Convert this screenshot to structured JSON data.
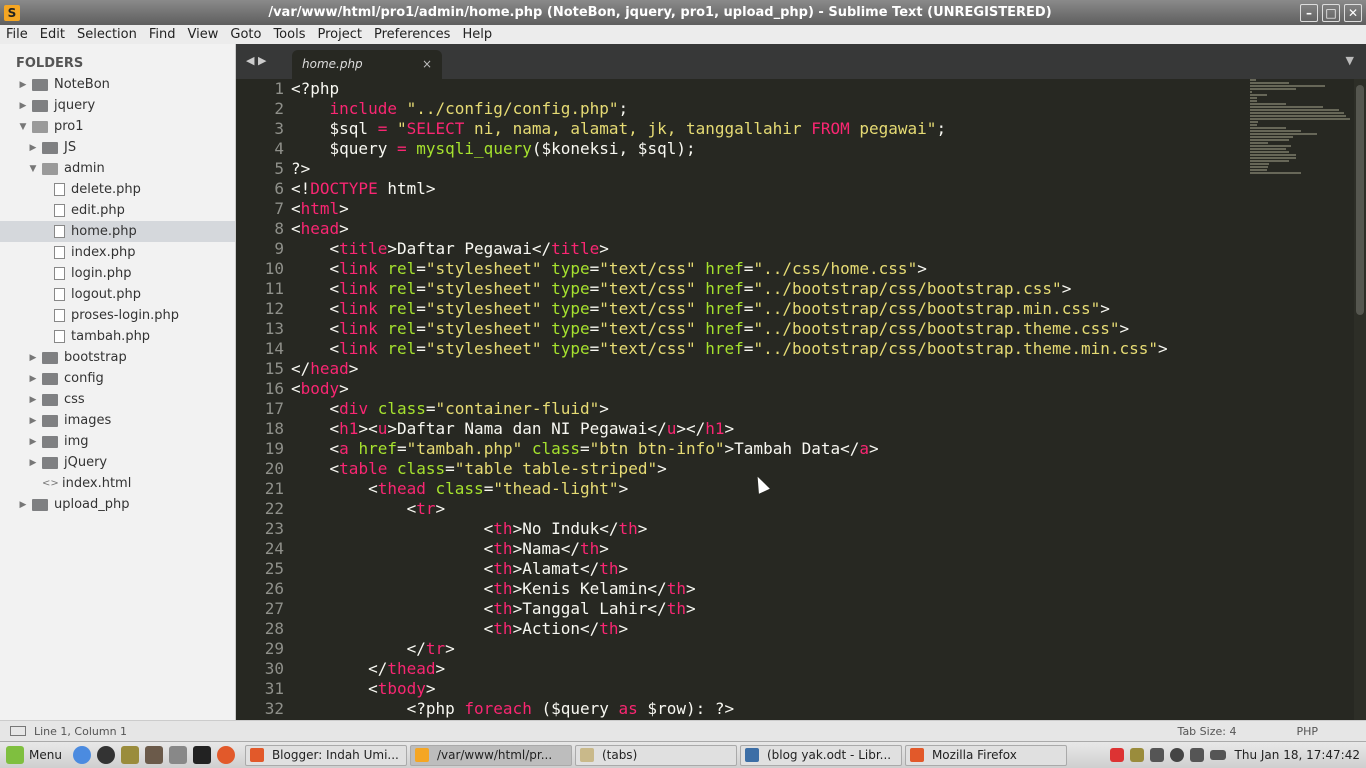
{
  "window": {
    "title": "/var/www/html/pro1/admin/home.php (NoteBon, jquery, pro1, upload_php) - Sublime Text (UNREGISTERED)",
    "minimize": "–",
    "maximize": "□",
    "close": "✕"
  },
  "menu": [
    "File",
    "Edit",
    "Selection",
    "Find",
    "View",
    "Goto",
    "Tools",
    "Project",
    "Preferences",
    "Help"
  ],
  "sidebar": {
    "header": "FOLDERS",
    "items": [
      {
        "label": "NoteBon",
        "type": "folder",
        "depth": 0,
        "expanded": false
      },
      {
        "label": "jquery",
        "type": "folder",
        "depth": 0,
        "expanded": false
      },
      {
        "label": "pro1",
        "type": "folder",
        "depth": 0,
        "expanded": true
      },
      {
        "label": "JS",
        "type": "folder",
        "depth": 1,
        "expanded": false
      },
      {
        "label": "admin",
        "type": "folder",
        "depth": 1,
        "expanded": true
      },
      {
        "label": "delete.php",
        "type": "file",
        "depth": 2
      },
      {
        "label": "edit.php",
        "type": "file",
        "depth": 2
      },
      {
        "label": "home.php",
        "type": "file",
        "depth": 2,
        "selected": true
      },
      {
        "label": "index.php",
        "type": "file",
        "depth": 2
      },
      {
        "label": "login.php",
        "type": "file",
        "depth": 2
      },
      {
        "label": "logout.php",
        "type": "file",
        "depth": 2
      },
      {
        "label": "proses-login.php",
        "type": "file",
        "depth": 2
      },
      {
        "label": "tambah.php",
        "type": "file",
        "depth": 2
      },
      {
        "label": "bootstrap",
        "type": "folder",
        "depth": 1,
        "expanded": false
      },
      {
        "label": "config",
        "type": "folder",
        "depth": 1,
        "expanded": false
      },
      {
        "label": "css",
        "type": "folder",
        "depth": 1,
        "expanded": false
      },
      {
        "label": "images",
        "type": "folder",
        "depth": 1,
        "expanded": false
      },
      {
        "label": "img",
        "type": "folder",
        "depth": 1,
        "expanded": false
      },
      {
        "label": "jQuery",
        "type": "folder",
        "depth": 1,
        "expanded": false
      },
      {
        "label": "index.html",
        "type": "html",
        "depth": 1
      },
      {
        "label": "upload_php",
        "type": "folder",
        "depth": 0,
        "expanded": false
      }
    ]
  },
  "tab": {
    "label": "home.php",
    "close": "×"
  },
  "code_lines": [
    [
      [
        "",
        "<?php"
      ]
    ],
    [
      [
        "",
        "    "
      ],
      [
        "t",
        "include"
      ],
      [
        "",
        " "
      ],
      [
        "s",
        "\"../config/config.php\""
      ],
      [
        "",
        ";"
      ]
    ],
    [
      [
        "",
        "    $sql "
      ],
      [
        "t",
        "="
      ],
      [
        "",
        " "
      ],
      [
        "s",
        "\""
      ],
      [
        "t",
        "SELECT"
      ],
      [
        "s",
        " ni, nama, alamat, jk, tanggallahir "
      ],
      [
        "t",
        "FROM"
      ],
      [
        "s",
        " pegawai\""
      ],
      [
        "",
        ";"
      ]
    ],
    [
      [
        "",
        "    $query "
      ],
      [
        "t",
        "="
      ],
      [
        "",
        " "
      ],
      [
        "a",
        "mysqli_query"
      ],
      [
        "",
        "($koneksi, $sql);"
      ]
    ],
    [
      [
        "",
        "?>"
      ]
    ],
    [
      [
        "",
        "<!"
      ],
      [
        "t",
        "DOCTYPE"
      ],
      [
        "",
        " html>"
      ]
    ],
    [
      [
        "",
        "<"
      ],
      [
        "t",
        "html"
      ],
      [
        "",
        ">"
      ]
    ],
    [
      [
        "",
        "<"
      ],
      [
        "t",
        "head"
      ],
      [
        "",
        ">"
      ]
    ],
    [
      [
        "",
        "    <"
      ],
      [
        "t",
        "title"
      ],
      [
        "",
        ">Daftar Pegawai</"
      ],
      [
        "t",
        "title"
      ],
      [
        "",
        ">"
      ]
    ],
    [
      [
        "",
        "    <"
      ],
      [
        "t",
        "link"
      ],
      [
        "",
        " "
      ],
      [
        "a",
        "rel"
      ],
      [
        "",
        "="
      ],
      [
        "s",
        "\"stylesheet\""
      ],
      [
        "",
        " "
      ],
      [
        "a",
        "type"
      ],
      [
        "",
        "="
      ],
      [
        "s",
        "\"text/css\""
      ],
      [
        "",
        " "
      ],
      [
        "a",
        "href"
      ],
      [
        "",
        "="
      ],
      [
        "s",
        "\"../css/home.css\""
      ],
      [
        "",
        ">"
      ]
    ],
    [
      [
        "",
        "    <"
      ],
      [
        "t",
        "link"
      ],
      [
        "",
        " "
      ],
      [
        "a",
        "rel"
      ],
      [
        "",
        "="
      ],
      [
        "s",
        "\"stylesheet\""
      ],
      [
        "",
        " "
      ],
      [
        "a",
        "type"
      ],
      [
        "",
        "="
      ],
      [
        "s",
        "\"text/css\""
      ],
      [
        "",
        " "
      ],
      [
        "a",
        "href"
      ],
      [
        "",
        "="
      ],
      [
        "s",
        "\"../bootstrap/css/bootstrap.css\""
      ],
      [
        "",
        ">"
      ]
    ],
    [
      [
        "",
        "    <"
      ],
      [
        "t",
        "link"
      ],
      [
        "",
        " "
      ],
      [
        "a",
        "rel"
      ],
      [
        "",
        "="
      ],
      [
        "s",
        "\"stylesheet\""
      ],
      [
        "",
        " "
      ],
      [
        "a",
        "type"
      ],
      [
        "",
        "="
      ],
      [
        "s",
        "\"text/css\""
      ],
      [
        "",
        " "
      ],
      [
        "a",
        "href"
      ],
      [
        "",
        "="
      ],
      [
        "s",
        "\"../bootstrap/css/bootstrap.min.css\""
      ],
      [
        "",
        ">"
      ]
    ],
    [
      [
        "",
        "    <"
      ],
      [
        "t",
        "link"
      ],
      [
        "",
        " "
      ],
      [
        "a",
        "rel"
      ],
      [
        "",
        "="
      ],
      [
        "s",
        "\"stylesheet\""
      ],
      [
        "",
        " "
      ],
      [
        "a",
        "type"
      ],
      [
        "",
        "="
      ],
      [
        "s",
        "\"text/css\""
      ],
      [
        "",
        " "
      ],
      [
        "a",
        "href"
      ],
      [
        "",
        "="
      ],
      [
        "s",
        "\"../bootstrap/css/bootstrap.theme.css\""
      ],
      [
        "",
        ">"
      ]
    ],
    [
      [
        "",
        "    <"
      ],
      [
        "t",
        "link"
      ],
      [
        "",
        " "
      ],
      [
        "a",
        "rel"
      ],
      [
        "",
        "="
      ],
      [
        "s",
        "\"stylesheet\""
      ],
      [
        "",
        " "
      ],
      [
        "a",
        "type"
      ],
      [
        "",
        "="
      ],
      [
        "s",
        "\"text/css\""
      ],
      [
        "",
        " "
      ],
      [
        "a",
        "href"
      ],
      [
        "",
        "="
      ],
      [
        "s",
        "\"../bootstrap/css/bootstrap.theme.min.css\""
      ],
      [
        "",
        ">"
      ]
    ],
    [
      [
        "",
        "</"
      ],
      [
        "t",
        "head"
      ],
      [
        "",
        ">"
      ]
    ],
    [
      [
        "",
        "<"
      ],
      [
        "t",
        "body"
      ],
      [
        "",
        ">"
      ]
    ],
    [
      [
        "",
        "    <"
      ],
      [
        "t",
        "div"
      ],
      [
        "",
        " "
      ],
      [
        "a",
        "class"
      ],
      [
        "",
        "="
      ],
      [
        "s",
        "\"container-fluid\""
      ],
      [
        "",
        ">"
      ]
    ],
    [
      [
        "",
        "    <"
      ],
      [
        "t",
        "h1"
      ],
      [
        "",
        "><"
      ],
      [
        "t",
        "u"
      ],
      [
        "",
        ">Daftar Nama dan NI Pegawai</"
      ],
      [
        "t",
        "u"
      ],
      [
        "",
        "></"
      ],
      [
        "t",
        "h1"
      ],
      [
        "",
        ">"
      ]
    ],
    [
      [
        "",
        "    <"
      ],
      [
        "t",
        "a"
      ],
      [
        "",
        " "
      ],
      [
        "a",
        "href"
      ],
      [
        "",
        "="
      ],
      [
        "s",
        "\"tambah.php\""
      ],
      [
        "",
        " "
      ],
      [
        "a",
        "class"
      ],
      [
        "",
        "="
      ],
      [
        "s",
        "\"btn btn-info\""
      ],
      [
        "",
        ">Tambah Data</"
      ],
      [
        "t",
        "a"
      ],
      [
        "",
        ">"
      ]
    ],
    [
      [
        "",
        "    <"
      ],
      [
        "t",
        "table"
      ],
      [
        "",
        " "
      ],
      [
        "a",
        "class"
      ],
      [
        "",
        "="
      ],
      [
        "s",
        "\"table table-striped\""
      ],
      [
        "",
        ">"
      ]
    ],
    [
      [
        "",
        "        <"
      ],
      [
        "t",
        "thead"
      ],
      [
        "",
        " "
      ],
      [
        "a",
        "class"
      ],
      [
        "",
        "="
      ],
      [
        "s",
        "\"thead-light\""
      ],
      [
        "",
        ">"
      ]
    ],
    [
      [
        "",
        "            <"
      ],
      [
        "t",
        "tr"
      ],
      [
        "",
        ">"
      ]
    ],
    [
      [
        "",
        "                    <"
      ],
      [
        "t",
        "th"
      ],
      [
        "",
        ">No Induk</"
      ],
      [
        "t",
        "th"
      ],
      [
        "",
        ">"
      ]
    ],
    [
      [
        "",
        "                    <"
      ],
      [
        "t",
        "th"
      ],
      [
        "",
        ">Nama</"
      ],
      [
        "t",
        "th"
      ],
      [
        "",
        ">"
      ]
    ],
    [
      [
        "",
        "                    <"
      ],
      [
        "t",
        "th"
      ],
      [
        "",
        ">Alamat</"
      ],
      [
        "t",
        "th"
      ],
      [
        "",
        ">"
      ]
    ],
    [
      [
        "",
        "                    <"
      ],
      [
        "t",
        "th"
      ],
      [
        "",
        ">Kenis Kelamin</"
      ],
      [
        "t",
        "th"
      ],
      [
        "",
        ">"
      ]
    ],
    [
      [
        "",
        "                    <"
      ],
      [
        "t",
        "th"
      ],
      [
        "",
        ">Tanggal Lahir</"
      ],
      [
        "t",
        "th"
      ],
      [
        "",
        ">"
      ]
    ],
    [
      [
        "",
        "                    <"
      ],
      [
        "t",
        "th"
      ],
      [
        "",
        ">Action</"
      ],
      [
        "t",
        "th"
      ],
      [
        "",
        ">"
      ]
    ],
    [
      [
        "",
        "            </"
      ],
      [
        "t",
        "tr"
      ],
      [
        "",
        ">"
      ]
    ],
    [
      [
        "",
        "        </"
      ],
      [
        "t",
        "thead"
      ],
      [
        "",
        ">"
      ]
    ],
    [
      [
        "",
        "        <"
      ],
      [
        "t",
        "tbody"
      ],
      [
        "",
        ">"
      ]
    ],
    [
      [
        "",
        "            <?php "
      ],
      [
        "k",
        "foreach"
      ],
      [
        "",
        " ($query "
      ],
      [
        "k",
        "as"
      ],
      [
        "",
        " $row): ?>"
      ]
    ]
  ],
  "status": {
    "position": "Line 1, Column 1",
    "tab_size": "Tab Size: 4",
    "syntax": "PHP"
  },
  "taskbar": {
    "menu_label": "Menu",
    "tasks": [
      {
        "label": "Blogger: Indah Umi...",
        "color": "#e2592a",
        "active": false
      },
      {
        "label": "/var/www/html/pr...",
        "color": "#f5a623",
        "active": true
      },
      {
        "label": "(tabs)",
        "color": "#c9b98a",
        "active": false
      },
      {
        "label": "(blog yak.odt - Libr...",
        "color": "#3c6ea6",
        "active": false
      },
      {
        "label": "Mozilla Firefox",
        "color": "#e2592a",
        "active": false
      }
    ],
    "clock": "Thu Jan 18, 17:47:42"
  }
}
